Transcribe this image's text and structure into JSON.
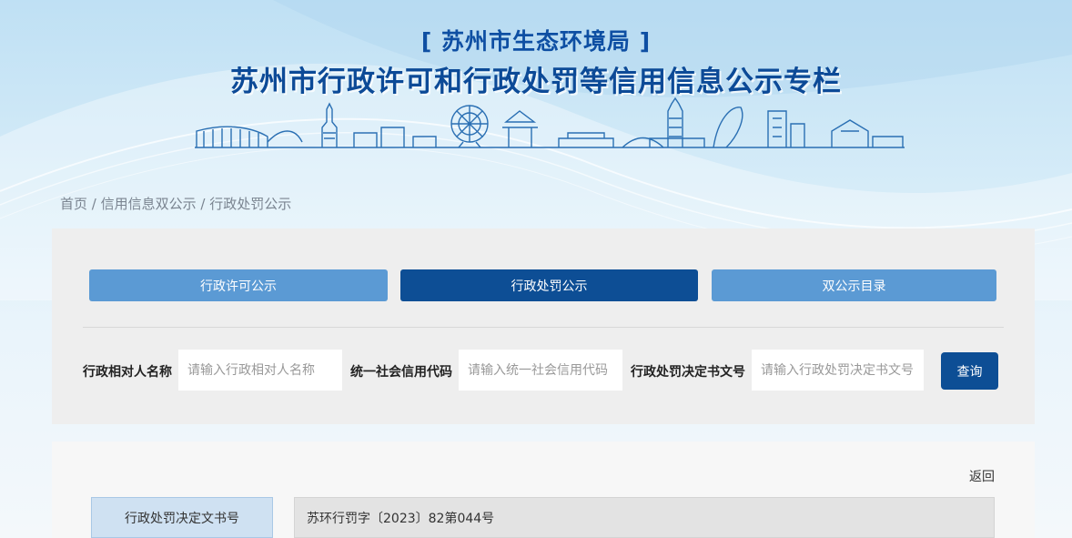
{
  "header": {
    "org_title": "[ 苏州市生态环境局 ]",
    "main_title": "苏州市行政许可和行政处罚等信用信息公示专栏"
  },
  "breadcrumb": {
    "home": "首页",
    "separator": " / ",
    "section": "信用信息双公示",
    "current": "行政处罚公示"
  },
  "tabs": [
    {
      "label": "行政许可公示",
      "active": false
    },
    {
      "label": "行政处罚公示",
      "active": true
    },
    {
      "label": "双公示目录",
      "active": false
    }
  ],
  "search": {
    "name_label": "行政相对人名称",
    "name_placeholder": "请输入行政相对人名称",
    "credit_code_label": "统一社会信用代码",
    "credit_code_placeholder": "请输入统一社会信用代码",
    "doc_no_label": "行政处罚决定书文号",
    "doc_no_placeholder": "请输入行政处罚决定书文号",
    "query_button": "查询"
  },
  "detail": {
    "back_label": "返回",
    "rows": [
      {
        "label": "行政处罚决定文书号",
        "value": "苏环行罚字〔2023〕82第044号"
      }
    ]
  },
  "colors": {
    "primary_dark": "#0d4e95",
    "tab_light": "#5b9ad4",
    "title_blue": "#0c4a97"
  }
}
